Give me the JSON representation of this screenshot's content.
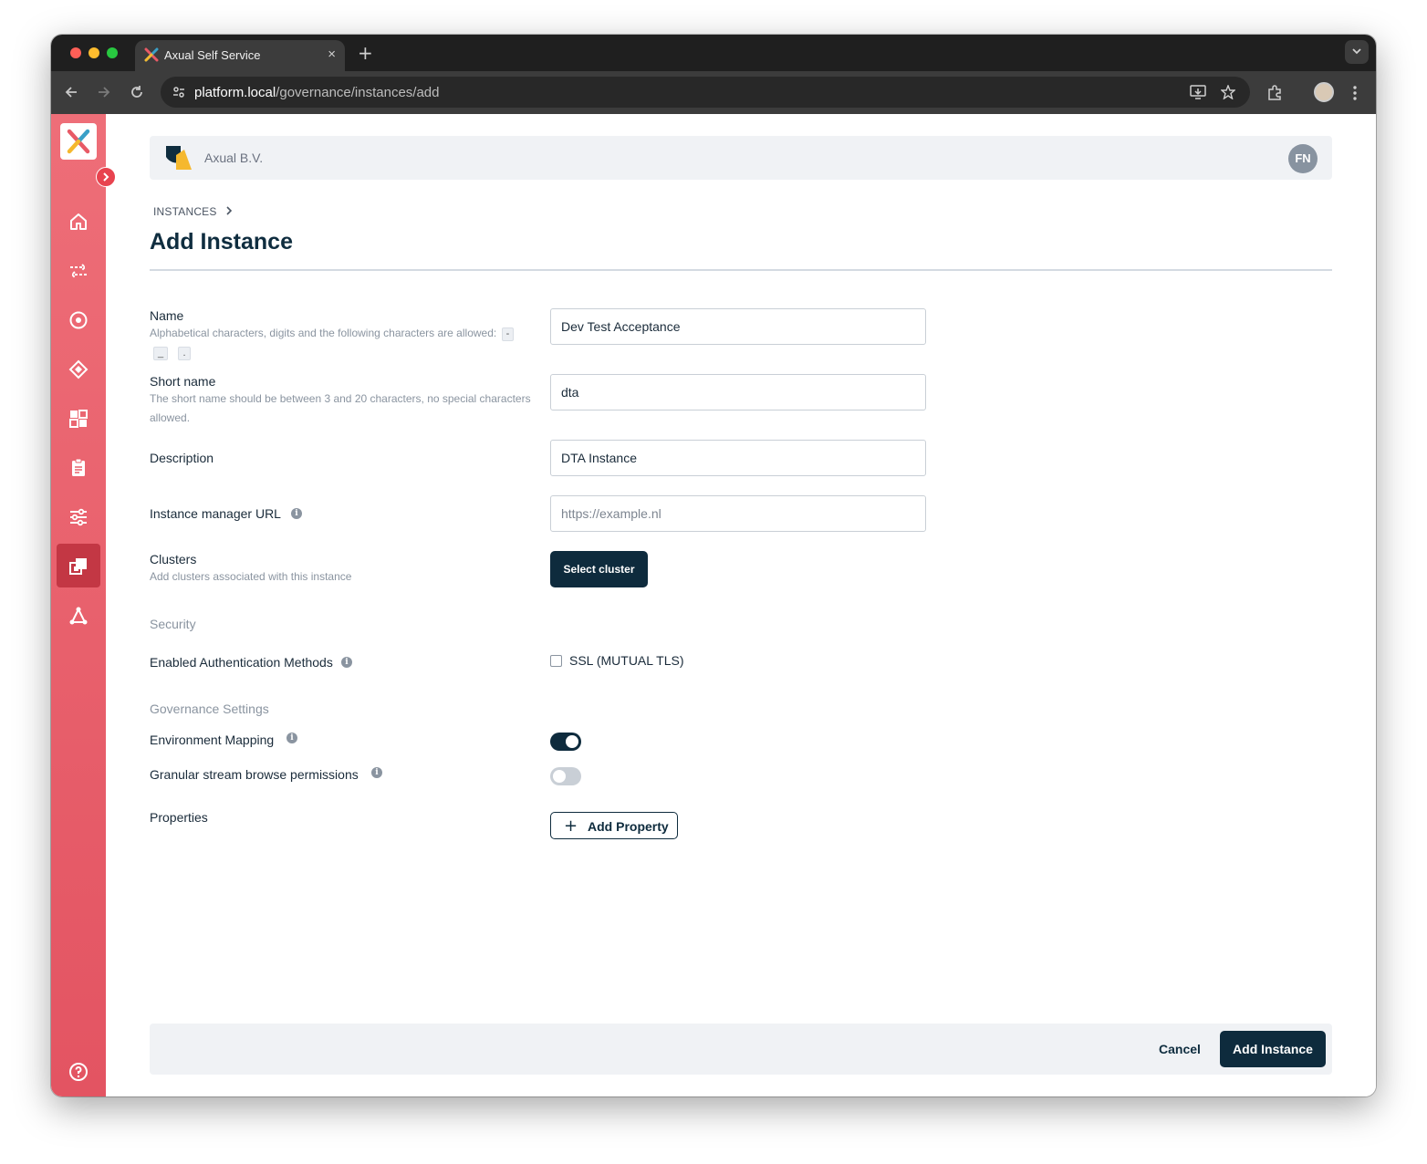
{
  "browser": {
    "tab_title": "Axual Self Service",
    "tab_close": "×",
    "new_tab": "+",
    "url_host": "platform.local",
    "url_path": "/governance/instances/add"
  },
  "header": {
    "org_name": "Axual B.V.",
    "avatar_initials": "FN"
  },
  "breadcrumb": "INSTANCES",
  "page_title": "Add Instance",
  "form": {
    "name": {
      "label": "Name",
      "hint": "Alphabetical characters, digits and the following characters are allowed:",
      "allowed_chars": [
        "-",
        "_",
        "."
      ],
      "value": "Dev Test Acceptance"
    },
    "short_name": {
      "label": "Short name",
      "hint": "The short name should be between 3 and 20 characters, no special characters allowed.",
      "value": "dta"
    },
    "description": {
      "label": "Description",
      "value": "DTA Instance"
    },
    "instance_manager_url": {
      "label": "Instance manager URL",
      "value": "",
      "placeholder": "https://example.nl"
    },
    "clusters": {
      "label": "Clusters",
      "hint": "Add clusters associated with this instance",
      "button": "Select cluster"
    },
    "security_section": "Security",
    "auth_methods": {
      "label": "Enabled Authentication Methods",
      "option": "SSL (MUTUAL TLS)",
      "checked": false
    },
    "governance_section": "Governance Settings",
    "environment_mapping": {
      "label": "Environment Mapping",
      "enabled": true
    },
    "granular_browse": {
      "label": "Granular stream browse permissions",
      "enabled": false
    },
    "properties": {
      "label": "Properties",
      "button": "Add Property"
    }
  },
  "footer": {
    "cancel": "Cancel",
    "submit": "Add Instance"
  },
  "colors": {
    "sidebar": "#e85a66",
    "primary": "#0e2b3d",
    "header_bg": "#f0f2f5"
  },
  "icons": [
    "home-icon",
    "streams-icon",
    "target-icon",
    "diamond-icon",
    "dashboard-icon",
    "clipboard-icon",
    "sliders-icon",
    "instances-icon",
    "network-icon",
    "help-icon"
  ]
}
